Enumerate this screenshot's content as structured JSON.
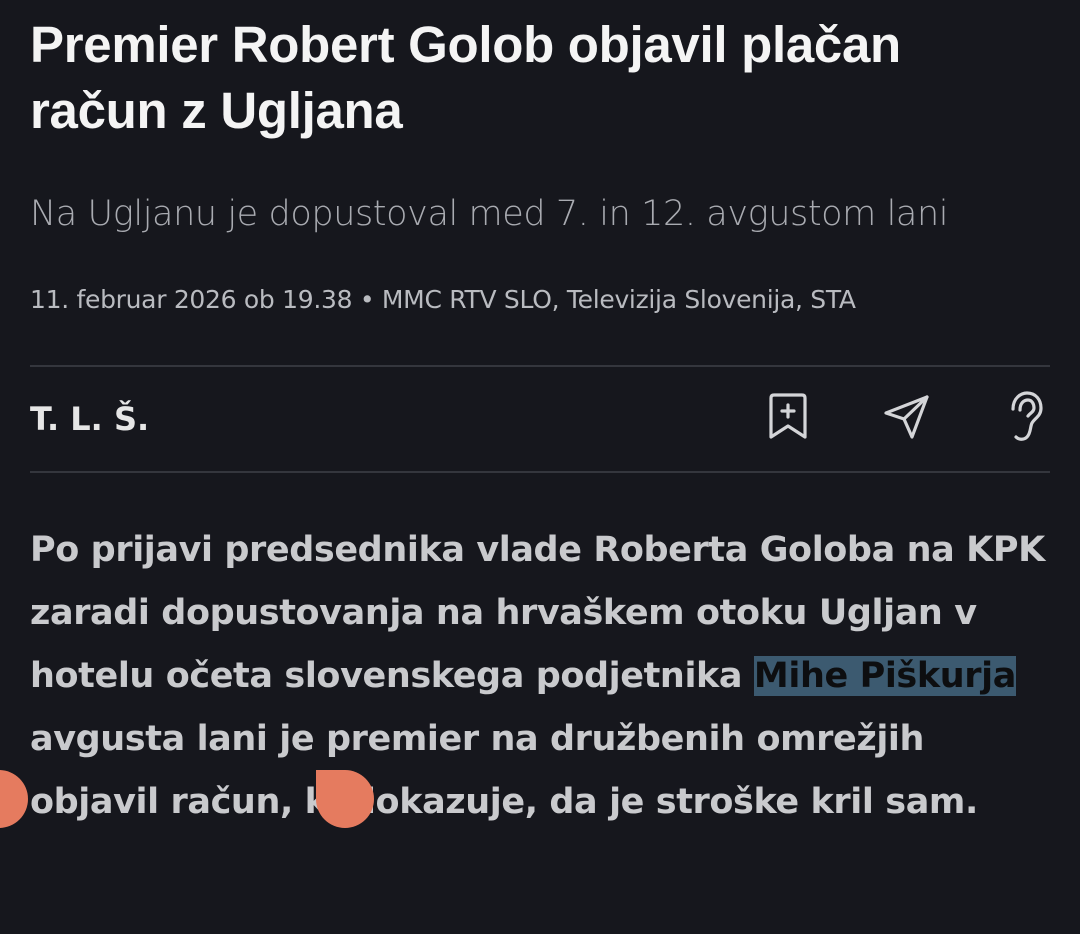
{
  "article": {
    "title": "Premier Robert Golob objavil plačan račun z Ugljana",
    "subtitle": "Na Ugljanu je dopustoval med 7. in 12. avgustom lani",
    "meta": "11. februar 2026 ob 19.38 • MMC RTV SLO, Televizija Slovenija, STA",
    "author": "T. L. Š.",
    "lead_before": "Po prijavi predsednika vlade Roberta Goloba na KPK zaradi dopustovanja na hrvaškem otoku Ugljan v hotelu očeta slovenskega podjetnika ",
    "lead_selected": "Mihe Piškurja",
    "lead_after": " avgusta lani je premier na družbenih omrežjih objavil račun, ki dokazuje, da je stroške kril sam."
  },
  "actions": [
    {
      "icon": "bookmark-add-icon"
    },
    {
      "icon": "send-icon"
    },
    {
      "icon": "listen-ear-icon"
    }
  ],
  "colors": {
    "background": "#16171d",
    "selection": "#3c5a70",
    "selection_handle": "#e57b5f"
  }
}
